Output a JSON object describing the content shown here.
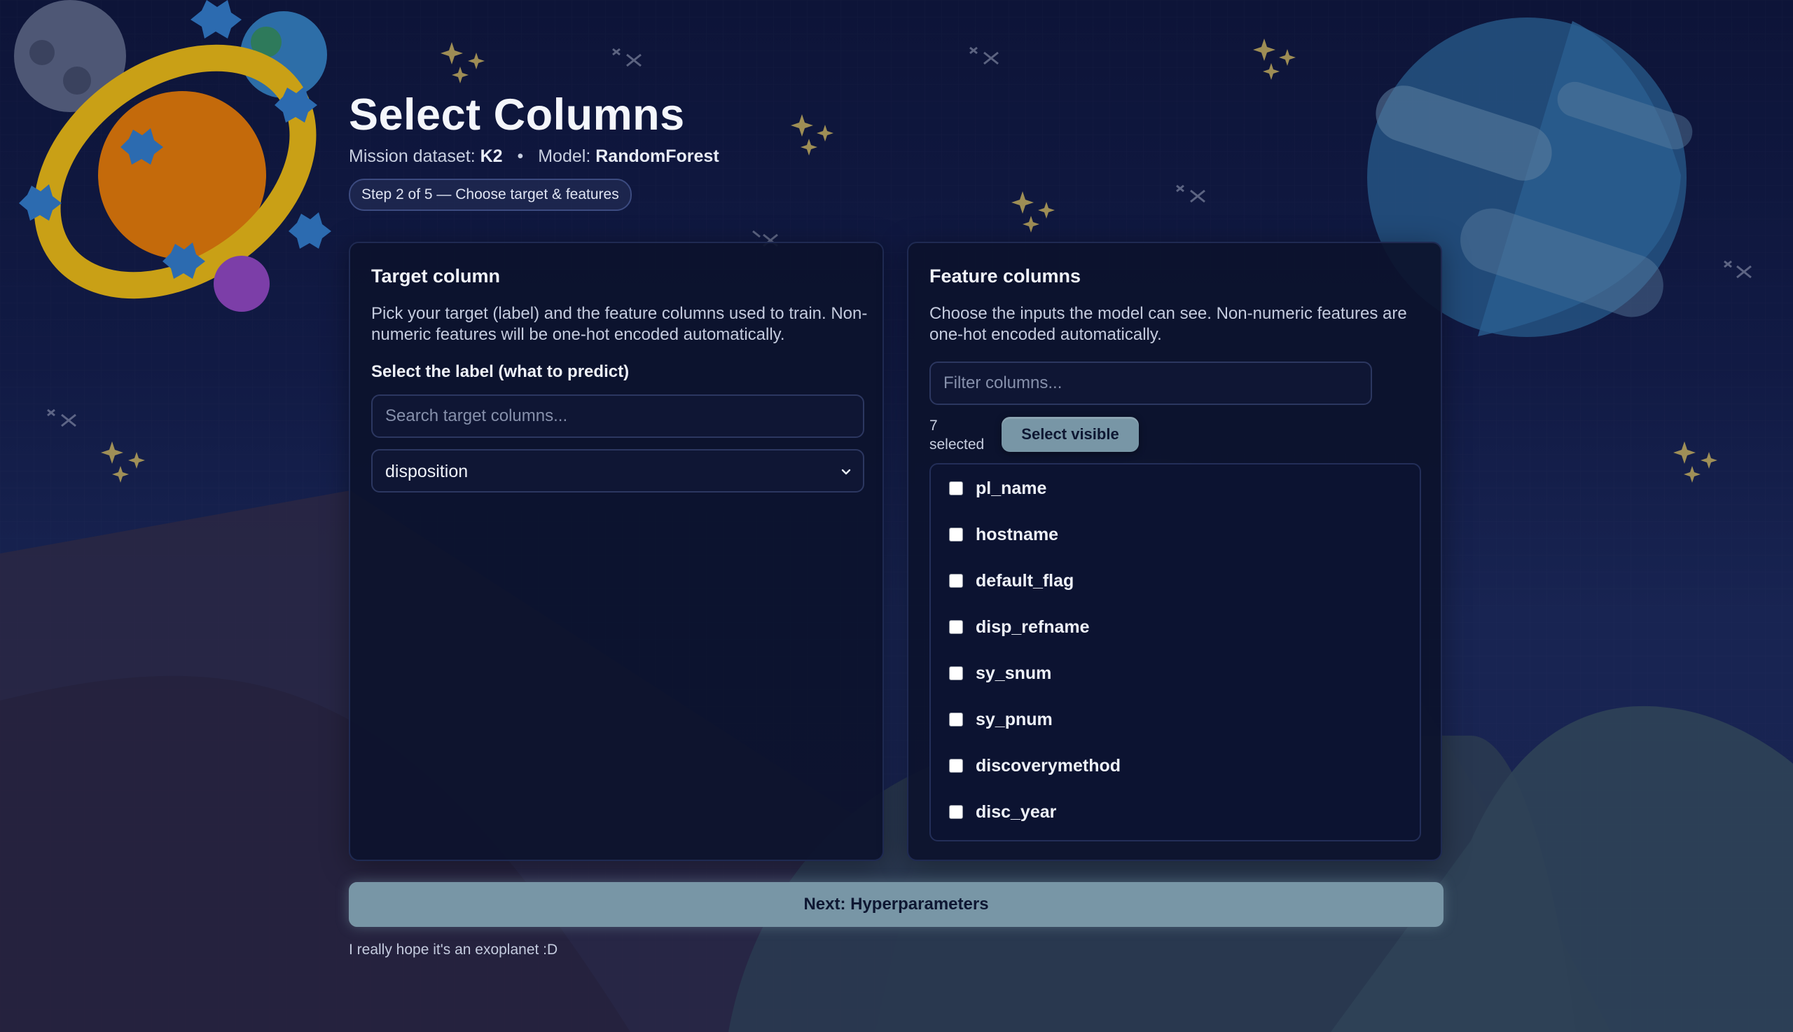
{
  "header": {
    "title": "Select Columns",
    "dataset_prefix": "Mission dataset:",
    "dataset": "K2",
    "separator": "•",
    "model_prefix": "Model:",
    "model": "RandomForest",
    "step": "Step 2 of 5 — Choose target & features"
  },
  "target_panel": {
    "title": "Target column",
    "description": "Pick your target (label) and the feature columns used to train. Non-numeric features will be one-hot encoded automatically.",
    "label": "Select the label (what to predict)",
    "search_placeholder": "Search target columns...",
    "selected": "disposition"
  },
  "feature_panel": {
    "title": "Feature columns",
    "description": "Choose the inputs the model can see. Non-numeric features are one-hot encoded automatically.",
    "filter_placeholder": "Filter columns...",
    "selected_count": "7",
    "selected_word": "selected",
    "select_visible_label": "Select visible",
    "columns": [
      {
        "name": "pl_name",
        "checked": false
      },
      {
        "name": "hostname",
        "checked": false
      },
      {
        "name": "default_flag",
        "checked": false
      },
      {
        "name": "disp_refname",
        "checked": false
      },
      {
        "name": "sy_snum",
        "checked": false
      },
      {
        "name": "sy_pnum",
        "checked": false
      },
      {
        "name": "discoverymethod",
        "checked": false
      },
      {
        "name": "disc_year",
        "checked": false
      }
    ]
  },
  "actions": {
    "next_label": "Next: Hyperparameters"
  },
  "footer": {
    "note": "I really hope it's an exoplanet :D"
  },
  "colors": {
    "accent_button": "#7896a6",
    "background": "#111a44",
    "panel": "#0c122c"
  }
}
